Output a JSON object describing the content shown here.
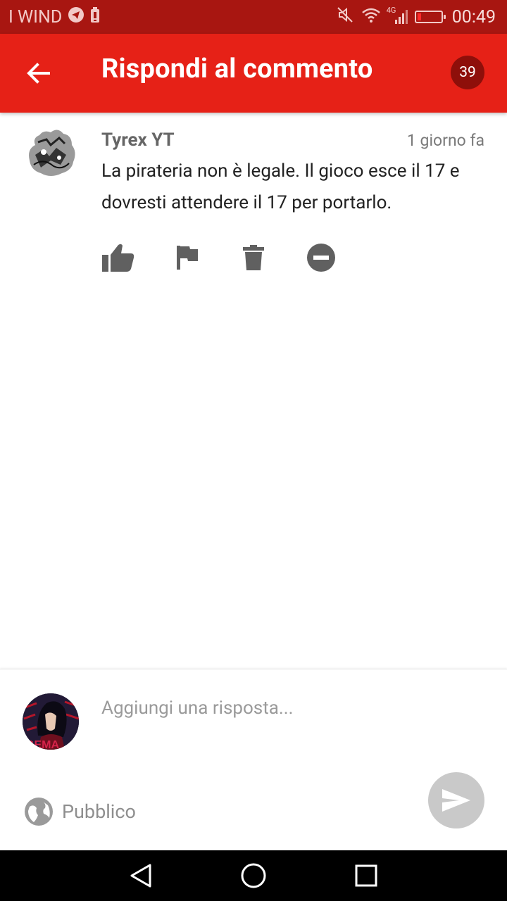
{
  "status_bar": {
    "carrier": "I WIND",
    "network": "4G",
    "time": "00:49",
    "battery_color": "#ff2b2b"
  },
  "app_bar": {
    "title": "Rispondi al commento",
    "count": "39",
    "background": "#e62117"
  },
  "comment": {
    "author": "Tyrex YT",
    "time": "1 giorno fa",
    "text": "La pirateria non è legale. Il gioco esce il 17 e dovresti attendere il 17 per portarlo.",
    "actions": [
      "thumbs-up-icon",
      "flag-icon",
      "trash-icon",
      "remove-circle-icon"
    ]
  },
  "reply": {
    "placeholder": "Aggiungi una risposta...",
    "visibility": "Pubblico",
    "avatar_text": "GEMA"
  },
  "nav_bar": {
    "buttons": [
      "back-triangle-icon",
      "home-circle-icon",
      "recents-square-icon"
    ]
  }
}
